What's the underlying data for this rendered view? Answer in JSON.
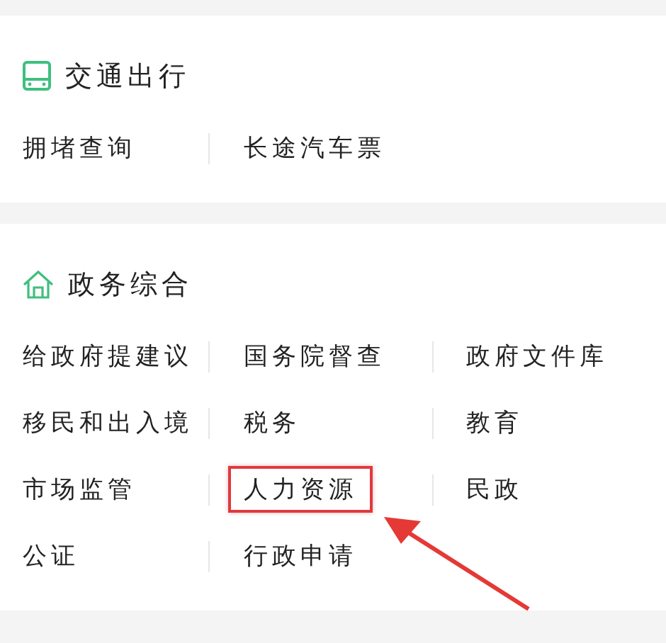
{
  "sections": [
    {
      "title": "交通出行",
      "kind": "bus",
      "items": [
        {
          "label": "拥堵查询",
          "highlighted": false
        },
        {
          "label": "长途汽车票",
          "highlighted": false
        }
      ]
    },
    {
      "title": "政务综合",
      "kind": "home",
      "items": [
        {
          "label": "给政府提建议",
          "highlighted": false
        },
        {
          "label": "国务院督查",
          "highlighted": false
        },
        {
          "label": "政府文件库",
          "highlighted": false
        },
        {
          "label": "移民和出入境",
          "highlighted": false
        },
        {
          "label": "税务",
          "highlighted": false
        },
        {
          "label": "教育",
          "highlighted": false
        },
        {
          "label": "市场监管",
          "highlighted": false
        },
        {
          "label": "人力资源",
          "highlighted": true
        },
        {
          "label": "民政",
          "highlighted": false
        },
        {
          "label": "公证",
          "highlighted": false
        },
        {
          "label": "行政申请",
          "highlighted": false
        }
      ]
    }
  ]
}
